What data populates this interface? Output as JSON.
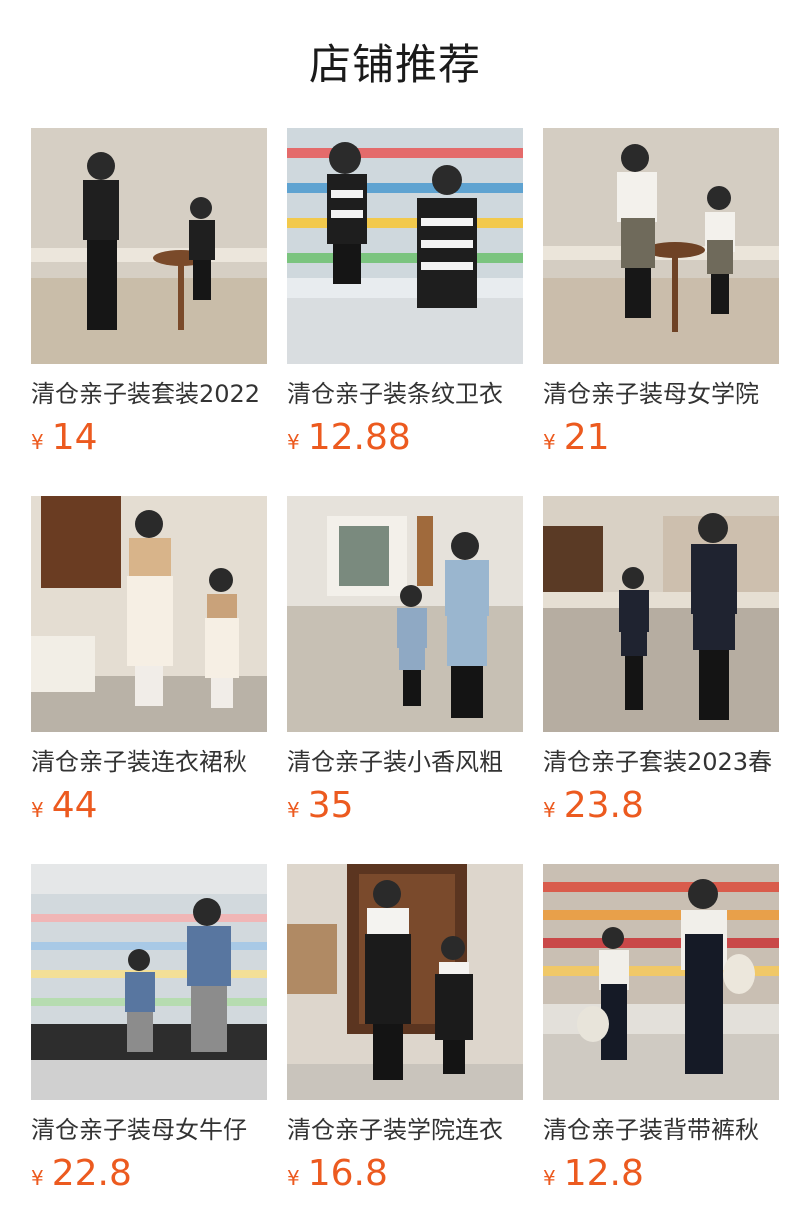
{
  "section": {
    "title": "店铺推荐"
  },
  "accent_color": "#ec5a1f",
  "currency_symbol": "¥",
  "products": [
    {
      "name": "清仓亲子装套装2022",
      "price": "14",
      "scene": "cafe"
    },
    {
      "name": "清仓亲子装条纹卫衣",
      "price": "12.88",
      "scene": "market"
    },
    {
      "name": "清仓亲子装母女学院",
      "price": "21",
      "scene": "cafe"
    },
    {
      "name": "清仓亲子装连衣裙秋",
      "price": "44",
      "scene": "street"
    },
    {
      "name": "清仓亲子装小香风粗",
      "price": "35",
      "scene": "lobby"
    },
    {
      "name": "清仓亲子套装2023春",
      "price": "23.8",
      "scene": "cafe"
    },
    {
      "name": "清仓亲子装母女牛仔",
      "price": "22.8",
      "scene": "market"
    },
    {
      "name": "清仓亲子装学院连衣",
      "price": "16.8",
      "scene": "doorway"
    },
    {
      "name": "清仓亲子装背带裤秋",
      "price": "12.8",
      "scene": "market"
    }
  ]
}
